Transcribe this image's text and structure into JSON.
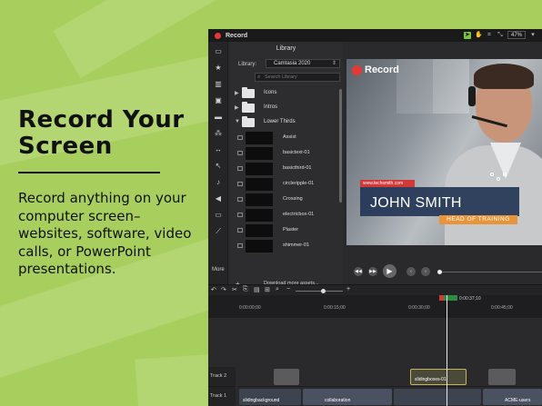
{
  "promo": {
    "headline_line1": "Record Your",
    "headline_line2": "Screen",
    "body": "Record anything on your computer screen–websites, software, video calls, or PowerPoint presentations."
  },
  "app": {
    "title": "Record",
    "zoom": "47%",
    "sidebar_more": "More",
    "library": {
      "title": "Library",
      "label": "Library:",
      "selected": "Camtasia 2020",
      "search_placeholder": "Search Library",
      "folders": [
        "Icons",
        "Intros",
        "Lower Thirds"
      ],
      "assets": [
        "Assist",
        "basictext-01",
        "basicthird-01",
        "circleripple-01",
        "Crossing",
        "electricbox-01",
        "Plaster",
        "shimmer-01"
      ],
      "download_link": "Download more assets..."
    },
    "canvas": {
      "rec_label": "Record",
      "url_text": "www.techsmith.com",
      "name": "JOHN SMITH",
      "role": "HEAD OF TRAINING"
    },
    "timeline": {
      "playhead_time": "0:00:37;10",
      "ticks": [
        "0:00:00;00",
        "0:00:15;00",
        "0:00:30;00",
        "0:00:45;00"
      ],
      "tracks": [
        {
          "label": "Track 2",
          "clips": [
            "slidingboxes-01"
          ]
        },
        {
          "label": "Track 1",
          "clips": [
            "slidingbackground",
            "collaboration",
            "ACME-users"
          ]
        }
      ]
    }
  }
}
